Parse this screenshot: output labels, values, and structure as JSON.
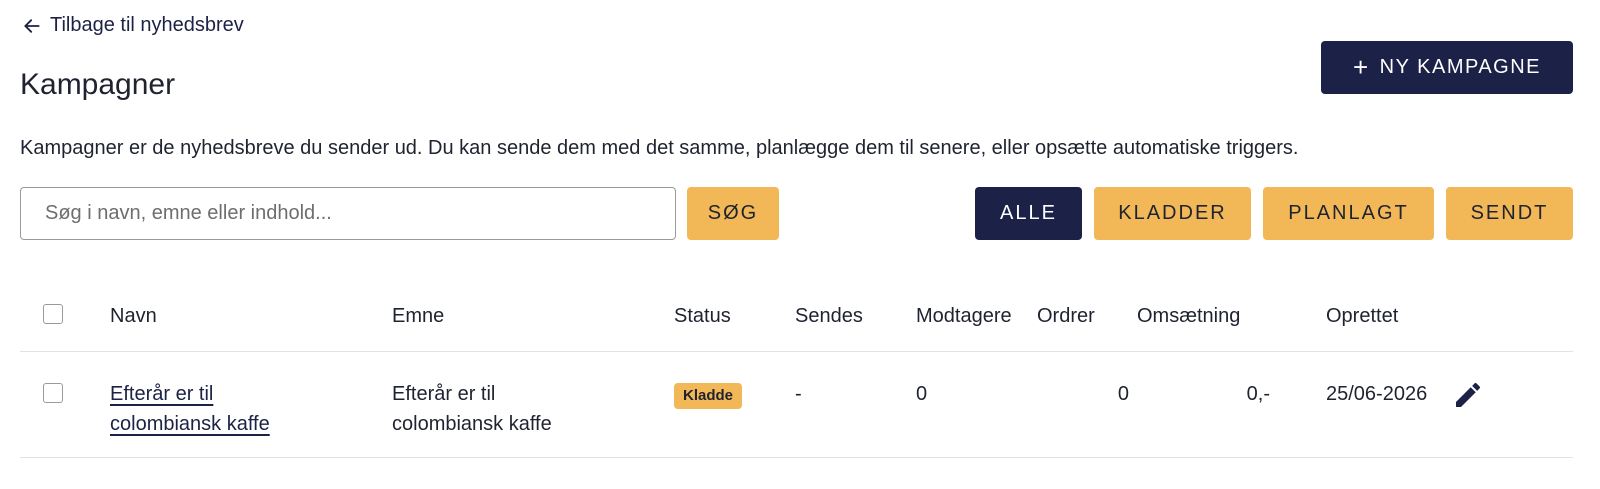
{
  "nav": {
    "back_label": "Tilbage til nyhedsbrev"
  },
  "page": {
    "title": "Kampagner",
    "description": "Kampagner er de nyhedsbreve du sender ud. Du kan sende dem med det samme, planlægge dem til senere, eller opsætte automatiske triggers.",
    "new_campaign_label": "NY KAMPAGNE"
  },
  "search": {
    "placeholder": "Søg i navn, emne eller indhold...",
    "value": "",
    "button_label": "SØG"
  },
  "filters": {
    "all": "ALLE",
    "drafts": "KLADDER",
    "planned": "PLANLAGT",
    "sent": "SENDT",
    "active": "all"
  },
  "table": {
    "headers": {
      "name": "Navn",
      "subject": "Emne",
      "status": "Status",
      "sends": "Sendes",
      "recipients": "Modtagere",
      "orders": "Ordrer",
      "revenue": "Omsætning",
      "created": "Oprettet"
    },
    "rows": [
      {
        "name": "Efterår er til colombiansk kaffe",
        "subject": "Efterår er til colombiansk kaffe",
        "status": "Kladde",
        "sends": "-",
        "recipients": "0",
        "orders": "0",
        "revenue": "0,-",
        "created": "25/06-2026"
      }
    ]
  },
  "colors": {
    "primary_dark": "#1b2147",
    "accent_yellow": "#f2b757",
    "border": "#e2e2e2"
  },
  "icons": {
    "back": "arrow-left-icon",
    "add": "plus-icon",
    "edit": "pencil-icon"
  }
}
